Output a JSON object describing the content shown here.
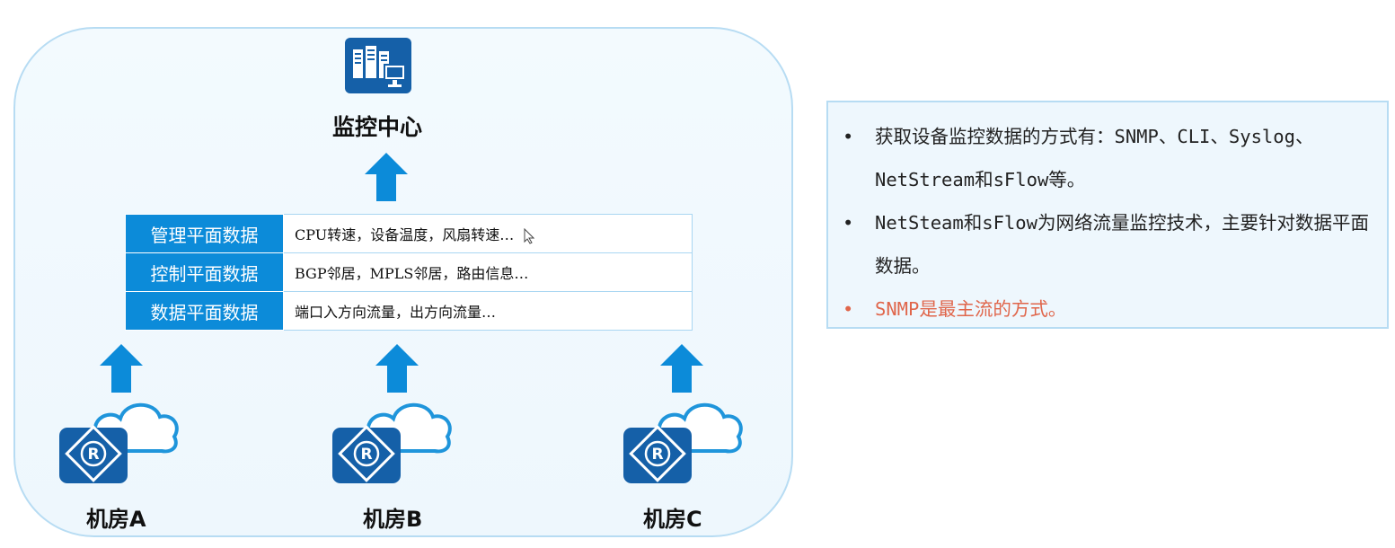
{
  "diagram": {
    "center_title": "监控中心",
    "icons": {
      "server": "server-monitor-icon",
      "arrow": "up-arrow-icon",
      "router": "router-cloud-icon",
      "cursor": "mouse-cursor-icon"
    },
    "rows": [
      {
        "label": "管理平面数据",
        "value": "CPU转速，设备温度，风扇转速…"
      },
      {
        "label": "控制平面数据",
        "value": "BGP邻居，MPLS邻居，路由信息…"
      },
      {
        "label": "数据平面数据",
        "value": "端口入方向流量，出方向流量…"
      }
    ],
    "rooms": [
      "机房A",
      "机房B",
      "机房C"
    ],
    "colors": {
      "accent": "#0c8bd9",
      "panel_border": "#b7dcf3",
      "panel_bg": "#eef7fd",
      "router": "#1560a8",
      "highlight": "#e0664b"
    }
  },
  "notes": {
    "items": [
      {
        "bullet": "•",
        "text": "获取设备监控数据的方式有：SNMP、CLI、Syslog、NetStream和sFlow等。",
        "highlight": false
      },
      {
        "bullet": "•",
        "text": "NetSteam和sFlow为网络流量监控技术，主要针对数据平面数据。",
        "highlight": false
      },
      {
        "bullet": "•",
        "text": "SNMP是最主流的方式。",
        "highlight": true
      }
    ]
  }
}
